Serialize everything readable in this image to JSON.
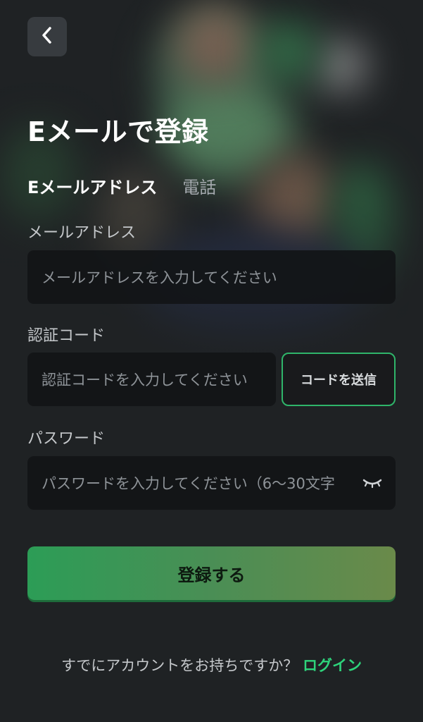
{
  "header": {
    "back_icon": "chevron-left-icon",
    "title": "Eメールで登録"
  },
  "tabs": [
    {
      "label": "Eメールアドレス",
      "active": true
    },
    {
      "label": "電話",
      "active": false
    }
  ],
  "form": {
    "email": {
      "label": "メールアドレス",
      "placeholder": "メールアドレスを入力してください"
    },
    "code": {
      "label": "認証コード",
      "placeholder": "認証コードを入力してください",
      "send_button": "コードを送信"
    },
    "password": {
      "label": "パスワード",
      "placeholder": "パスワードを入力してください（6〜30文字",
      "toggle_icon": "eye-closed-icon"
    },
    "submit_label": "登録する"
  },
  "footer": {
    "prompt": "すでにアカウントをお持ちですか？",
    "login_link": "ログイン"
  },
  "colors": {
    "accent": "#2ed47b",
    "button_gradient_start": "#2c9d56",
    "button_gradient_end": "#6a8a4a",
    "background": "#1f2224"
  }
}
